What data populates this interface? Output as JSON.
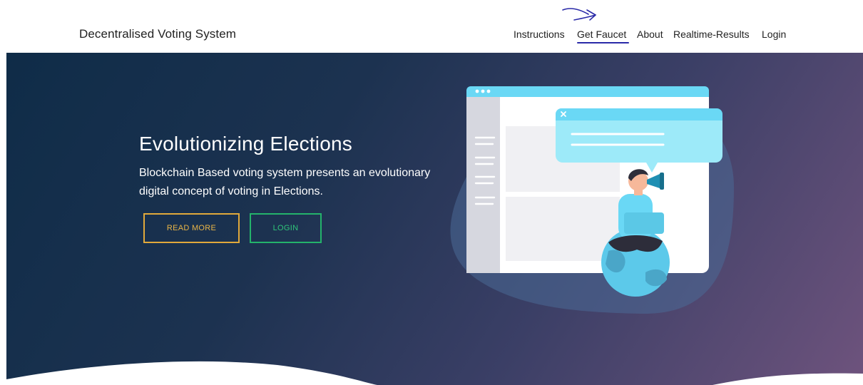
{
  "navbar": {
    "brand": "Decentralised Voting System",
    "links": [
      {
        "label": "Instructions"
      },
      {
        "label": "Get Faucet"
      },
      {
        "label": "About"
      },
      {
        "label": "Realtime-Results"
      },
      {
        "label": "Login"
      }
    ]
  },
  "hero": {
    "title": "Evolutionizing Elections",
    "description": "Blockchain Based voting system presents an evolutionary digital concept of voting in Elections.",
    "buttons": {
      "read_more": "READ MORE",
      "login": "LOGIN"
    }
  },
  "colors": {
    "gradient_start": "#0f2c48",
    "gradient_end": "#6e537d",
    "read_more_accent": "#e1a93b",
    "login_accent": "#24b36b",
    "underline": "#2a2aa8",
    "illustration_blue": "#6ad8f5"
  },
  "icons": {
    "annotation": "hand-drawn-arrow-icon",
    "close": "close-icon",
    "window_dots": "window-dots-icon"
  }
}
